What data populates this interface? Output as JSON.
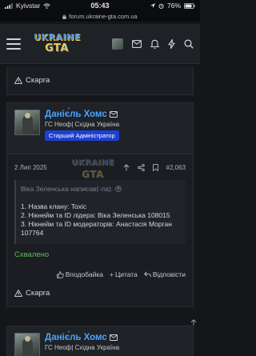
{
  "status_bar": {
    "carrier": "Kyivstar",
    "time": "05:43",
    "battery": "76%"
  },
  "browser": {
    "url": "forum.ukraine-gta.com.ua"
  },
  "header": {
    "logo_top": "UKRAINE",
    "logo_bottom": "GTA",
    "icons": [
      "menu-icon",
      "avatar",
      "mail-icon",
      "bell-icon",
      "bolt-icon",
      "search-icon"
    ]
  },
  "top_report": {
    "label": "Скарга"
  },
  "post": {
    "author_name": "Даніє́ль Хомс",
    "author_title": "ГС Неоф| Східна Україна",
    "role_badge": "Старший Адміністратор",
    "date": "2 Лип 2025",
    "post_number": "#2,063",
    "quote": {
      "author_line": "Віка Зеленська написав(-ла):",
      "lines": [
        "1. Назва клану: Toxic",
        "2. Нікнейм та ID лідера: Віка Зеленська 108015",
        "3. Нікнейм та ID модераторів: Анастасія Морган 107764"
      ]
    },
    "status_text": "Схвалено",
    "actions": {
      "like": "Вподобайка",
      "quote": "Цитата",
      "reply": "Відповісти"
    },
    "report_label": "Скарга"
  },
  "next_post": {
    "author_name": "Даніє́ль Хомс",
    "author_title": "ГС Неоф| Східна Україна"
  },
  "colors": {
    "background": "#14161a",
    "accent_blue": "#4aa3ff",
    "badge_blue": "#1f3fd0",
    "approved_green": "#5fbf5a"
  }
}
